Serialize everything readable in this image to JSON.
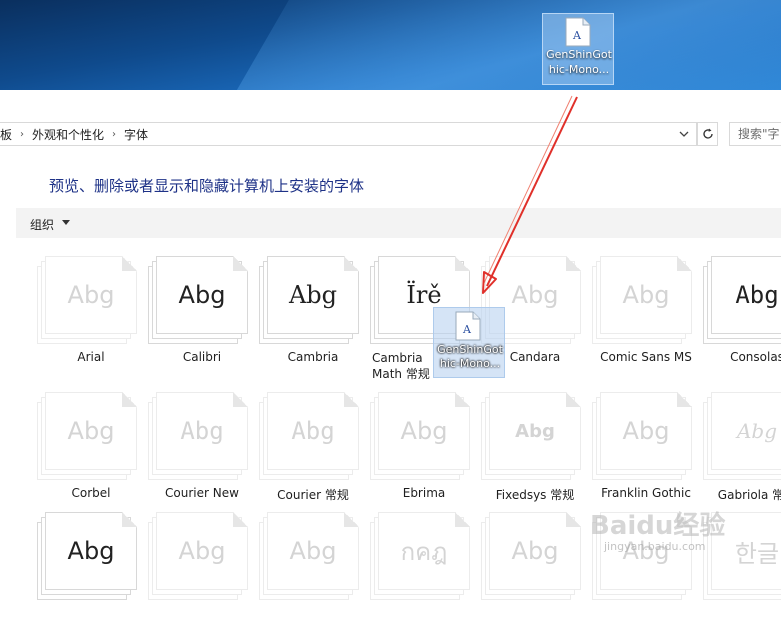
{
  "desktop": {
    "icon": {
      "label": "GenShinGothic-Mono...",
      "icon": "font-file-icon"
    }
  },
  "window": {
    "breadcrumb": [
      "板",
      "外观和个性化",
      "字体"
    ],
    "search_placeholder": "搜索\"字",
    "heading": "预览、删除或者显示和隐藏计算机上安装的字体",
    "toolbar": {
      "organize_label": "组织"
    }
  },
  "fonts": [
    {
      "name": "Arial",
      "sample": "Abg",
      "hidden": true
    },
    {
      "name": "Calibri",
      "sample": "Abg",
      "hidden": false
    },
    {
      "name": "Cambria",
      "sample": "Abg",
      "hidden": false
    },
    {
      "name": "Cambria Math 常规",
      "sample": "Ïrě",
      "hidden": false
    },
    {
      "name": "Candara",
      "sample": "Abg",
      "hidden": true
    },
    {
      "name": "Comic Sans MS",
      "sample": "Abg",
      "hidden": true
    },
    {
      "name": "Consolas",
      "sample": "Abg",
      "hidden": false
    },
    {
      "name": "Corbel",
      "sample": "Abg",
      "hidden": true
    },
    {
      "name": "Courier New",
      "sample": "Abg",
      "hidden": true
    },
    {
      "name": "Courier 常规",
      "sample": "Abg",
      "hidden": true
    },
    {
      "name": "Ebrima",
      "sample": "Abg",
      "hidden": true
    },
    {
      "name": "Fixedsys 常规",
      "sample": "Abg",
      "hidden": true
    },
    {
      "name": "Franklin Gothic",
      "sample": "Abg",
      "hidden": true
    },
    {
      "name": "Gabriola 常规",
      "sample": "Abg",
      "hidden": true
    },
    {
      "name": "",
      "sample": "Abg",
      "hidden": false
    },
    {
      "name": "",
      "sample": "Abg",
      "hidden": true
    },
    {
      "name": "",
      "sample": "Abg",
      "hidden": true
    },
    {
      "name": "",
      "sample": "กคฎ",
      "hidden": true
    },
    {
      "name": "",
      "sample": "Abg",
      "hidden": true
    },
    {
      "name": "",
      "sample": "Abg",
      "hidden": true
    },
    {
      "name": "",
      "sample": "한글",
      "hidden": true
    }
  ],
  "drag_ghost": {
    "label": "GenShinGothic-Mono..."
  },
  "watermark": {
    "text": "Baidu经验",
    "sub": "jingyan.baidu.com"
  }
}
